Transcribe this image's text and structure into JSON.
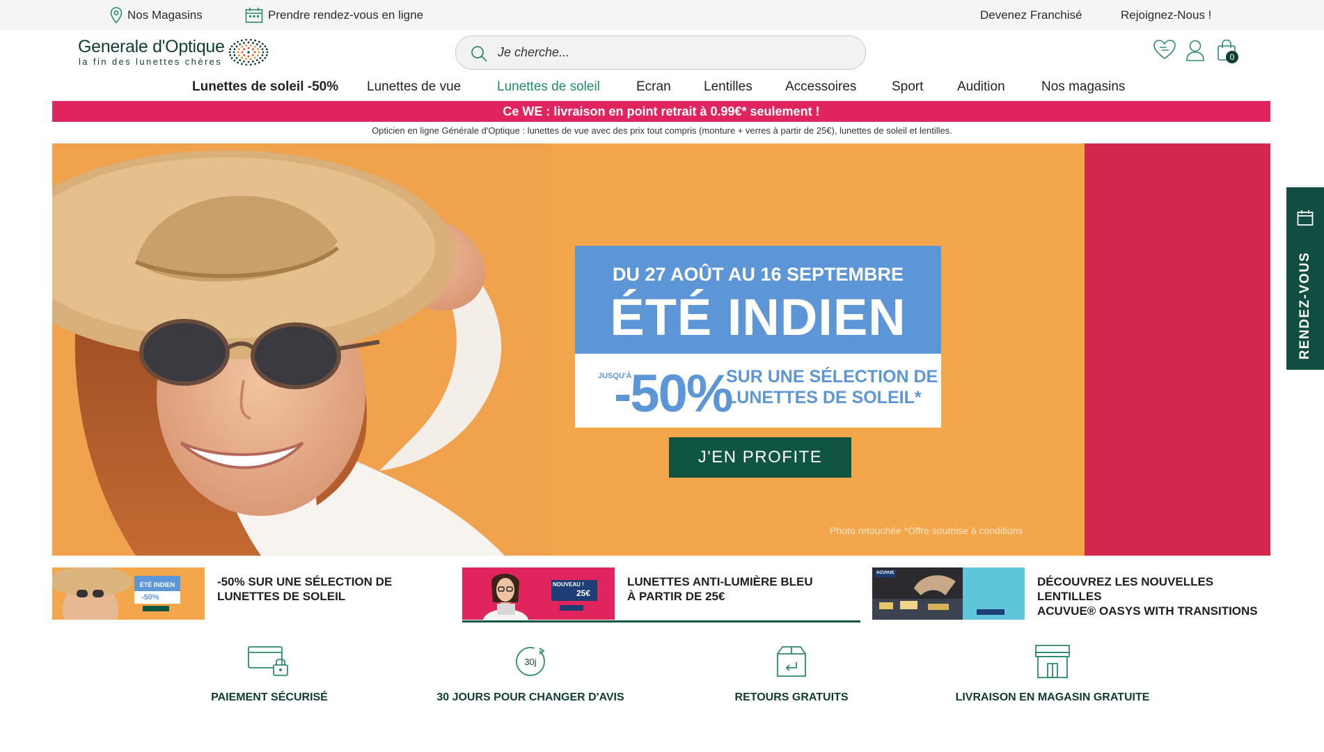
{
  "topbar": {
    "stores": "Nos Magasins",
    "appointment": "Prendre rendez-vous en ligne",
    "franchise": "Devenez Franchisé",
    "join": "Rejoignez-Nous !"
  },
  "header": {
    "brand": "Generale d'Optique",
    "tagline": "la fin des lunettes chères",
    "search_placeholder": "Je cherche...",
    "cart_count": "0"
  },
  "nav": {
    "items": [
      {
        "label": "Lunettes de soleil -50%"
      },
      {
        "label": "Lunettes de vue"
      },
      {
        "label": "Lunettes de soleil"
      },
      {
        "label": "Ecran"
      },
      {
        "label": "Lentilles"
      },
      {
        "label": "Accessoires"
      },
      {
        "label": "Sport"
      },
      {
        "label": "Audition"
      },
      {
        "label": "Nos magasins"
      }
    ]
  },
  "promo": {
    "text": "Ce WE : livraison en point retrait à 0.99€* seulement !",
    "seo": "Opticien en ligne Générale d'Optique : lunettes de vue avec des prix tout compris (monture + verres à partir de 25€), lunettes de soleil et lentilles."
  },
  "hero": {
    "dates": "DU 27 AOÛT AU 16 SEPTEMBRE",
    "title": "ÉTÉ INDIEN",
    "upto": "JUSQU'À",
    "percent": "-50%",
    "selection_line1": "SUR UNE SÉLECTION DE",
    "selection_line2": "LUNETTES DE SOLEIL*",
    "cta": "J'EN PROFITE",
    "legal": "Photo retouchée *Offre soumise à conditions"
  },
  "side_tab": {
    "label": "RENDEZ-VOUS"
  },
  "sub_banners": [
    {
      "line1": "-50% SUR UNE SÉLECTION DE",
      "line2": "LUNETTES DE SOLEIL",
      "thumb_title": "ÉTÉ INDIEN",
      "thumb_pct": "-50%"
    },
    {
      "line1": "LUNETTES ANTI-LUMIÈRE BLEU",
      "line2": "À PARTIR DE 25€",
      "thumb_title": "NOUVEAU !",
      "thumb_price": "25€"
    },
    {
      "line1": "DÉCOUVREZ LES NOUVELLES LENTILLES",
      "line2": "ACUVUE® OASYS WITH TRANSITIONS",
      "thumb_brand": "ACUVUE"
    }
  ],
  "reassurance": [
    {
      "label": "PAIEMENT SÉCURISÉ",
      "icon": "secure-card-icon"
    },
    {
      "label": "30 JOURS POUR CHANGER D'AVIS",
      "icon": "30-days-icon",
      "badge": "30j"
    },
    {
      "label": "RETOURS GRATUITS",
      "icon": "return-box-icon"
    },
    {
      "label": "LIVRAISON EN MAGASIN GRATUITE",
      "icon": "store-icon"
    }
  ],
  "colors": {
    "brand_green": "#0f3d35",
    "cta_green": "#0f5542",
    "promo_pink": "#e0245e",
    "hero_orange": "#f3a64a",
    "hero_blue": "#5d96d6",
    "nav_active": "#1c8c6a"
  }
}
